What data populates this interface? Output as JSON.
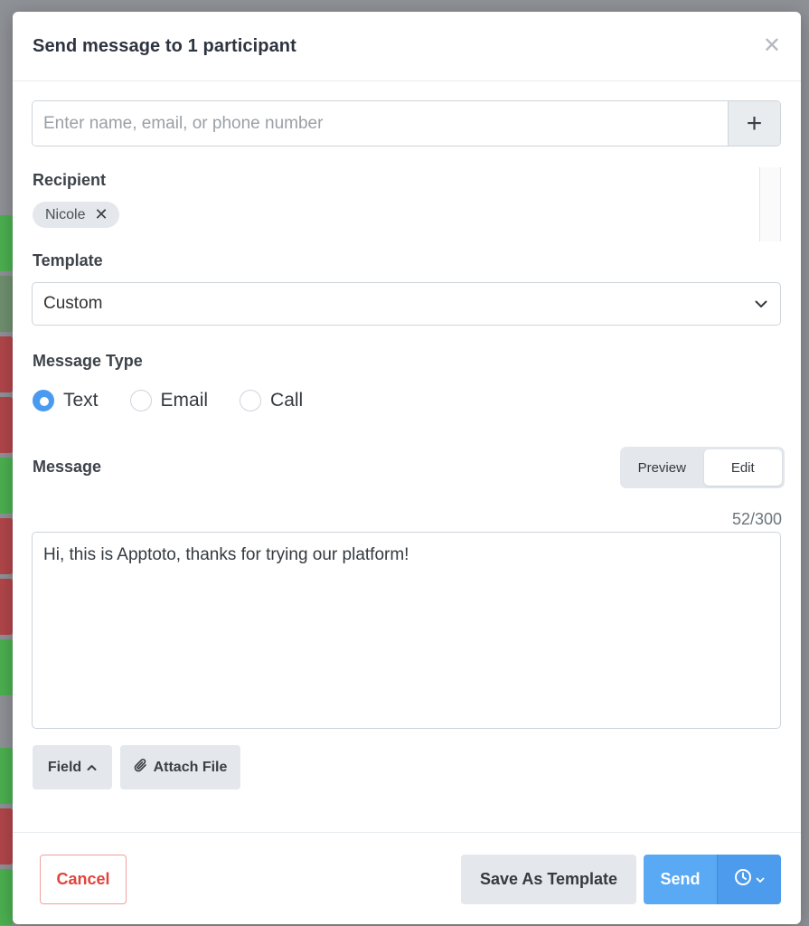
{
  "modal": {
    "title": "Send message to 1 participant",
    "close_icon": "close-icon"
  },
  "search": {
    "placeholder": "Enter name, email, or phone number",
    "value": "",
    "add_label": "+"
  },
  "recipient": {
    "label": "Recipient",
    "chips": [
      {
        "name": "Nicole",
        "remove": "✕"
      }
    ]
  },
  "template": {
    "label": "Template",
    "selected": "Custom"
  },
  "message_type": {
    "label": "Message Type",
    "options": [
      {
        "label": "Text",
        "checked": true
      },
      {
        "label": "Email",
        "checked": false
      },
      {
        "label": "Call",
        "checked": false
      }
    ]
  },
  "message": {
    "label": "Message",
    "toggle": {
      "preview": "Preview",
      "edit": "Edit",
      "active": "Edit"
    },
    "counter": "52/300",
    "body": "Hi, this is Apptoto, thanks for trying our platform!"
  },
  "tools": {
    "field_label": "Field",
    "attach_label": "Attach File"
  },
  "footer": {
    "cancel_label": "Cancel",
    "save_template_label": "Save As Template",
    "send_label": "Send",
    "schedule_icon": "clock-icon"
  },
  "colors": {
    "primary": "#5aa9f5",
    "danger": "#e0453d",
    "radio_checked": "#4a9af0"
  }
}
